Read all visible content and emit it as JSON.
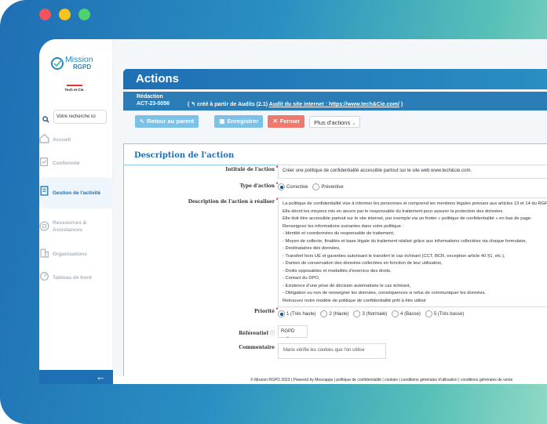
{
  "window_controls": [
    "close",
    "minimize",
    "maximize"
  ],
  "brand": {
    "name": "Mission",
    "sub": "RGPD",
    "company": "Tech et Cie."
  },
  "sidebar": {
    "search_placeholder": "Votre recherche ici",
    "items": [
      {
        "label": "Accueil",
        "icon": "home-icon"
      },
      {
        "label": "Conformité",
        "icon": "compliance-icon"
      },
      {
        "label": "Gestion de l'activité",
        "icon": "document-icon",
        "active": true
      },
      {
        "label": "Ressources & Assistances",
        "icon": "help-icon"
      },
      {
        "label": "Organisations",
        "icon": "building-icon"
      },
      {
        "label": "Tableau de bord",
        "icon": "dashboard-icon"
      }
    ]
  },
  "page": {
    "title": "Actions",
    "info": {
      "line1": "Rédaction",
      "code": "ACT-23-0056",
      "created_from": "( ↰ créé à partir de  Audits (2.1)",
      "link": "Audit du site internet : https://www.tech&Cie.com/",
      "close_paren": ")"
    },
    "toolbar": {
      "back": "Retour au parent",
      "save": "Enregistrer",
      "close": "Fermer",
      "more": "Plus d'actions"
    },
    "section_title": "Description de l'action",
    "fields": {
      "title_label": "Intitulé de l'action",
      "title_value": "Créer une politique de confidentialité accessible partout sur le site web www.tech&cie.com.",
      "type_label": "Type d'action",
      "type_options": [
        "Corrective",
        "Préventive"
      ],
      "desc_label": "Description de l'action à réaliser",
      "desc_lines": [
        "La politique de confidentialité vise à informer les personnes et comprend les mentions légales prévues aux articles 13 et 14 du RGPD.",
        "Elle décrit les moyens mis en œuvre par le responsable du traitement pour assurer la protection des données.",
        "Elle doit être accessible partout sur le site internet, par exemple via un footer « politique de confidentialité » en bas de page.",
        "Renseignez les informations suivantes dans votre politique :",
        "- Identité et coordonnées du responsable de traitement,",
        "- Moyen de collecte, finalités et base légale du traitement réalisé grâce aux informations collectées via chaque formulaire,",
        "- Destinataires des données,",
        "- Transfert hors UE et garanties autorisant le transfert le cas échéant (CCT, BCR, exception article 40 §1, etc.),",
        "- Durées de conservation des données collectées en fonction de leur utilisation,",
        "- Droits opposables et modalités d'exercice des droits,",
        "- Contact du DPO,",
        "- Existence d'une prise de décision automatisée le cas échéant,",
        "- Obligation ou non de renseigner les données, conséquences si refus de communiquer les données.",
        "Retrouvez notre modèle de politique de confidentialité prêt à être utilisé"
      ],
      "priority_label": "Priorité",
      "priority_options": [
        "1 (Très haute)",
        "2 (Haute)",
        "3 (Normale)",
        "4 (Basse)",
        "5 (Très basse)"
      ],
      "ref_label": "Référentiel",
      "ref_value": "RGPD",
      "comment_label": "Commentaire",
      "comment_value": "Mario vérifie les cookies que l'on utilise"
    },
    "footer": "© Mission RGPD 2023 | Powered by Moovapps | politique de confidentialité | cookies | conditions générales d'utilisation | conditions générales de vente"
  },
  "colors": {
    "accent": "#1f6fb4",
    "title_bar": "#2a8fc2",
    "danger": "#f0796e",
    "light_button": "#7cc2e8"
  }
}
